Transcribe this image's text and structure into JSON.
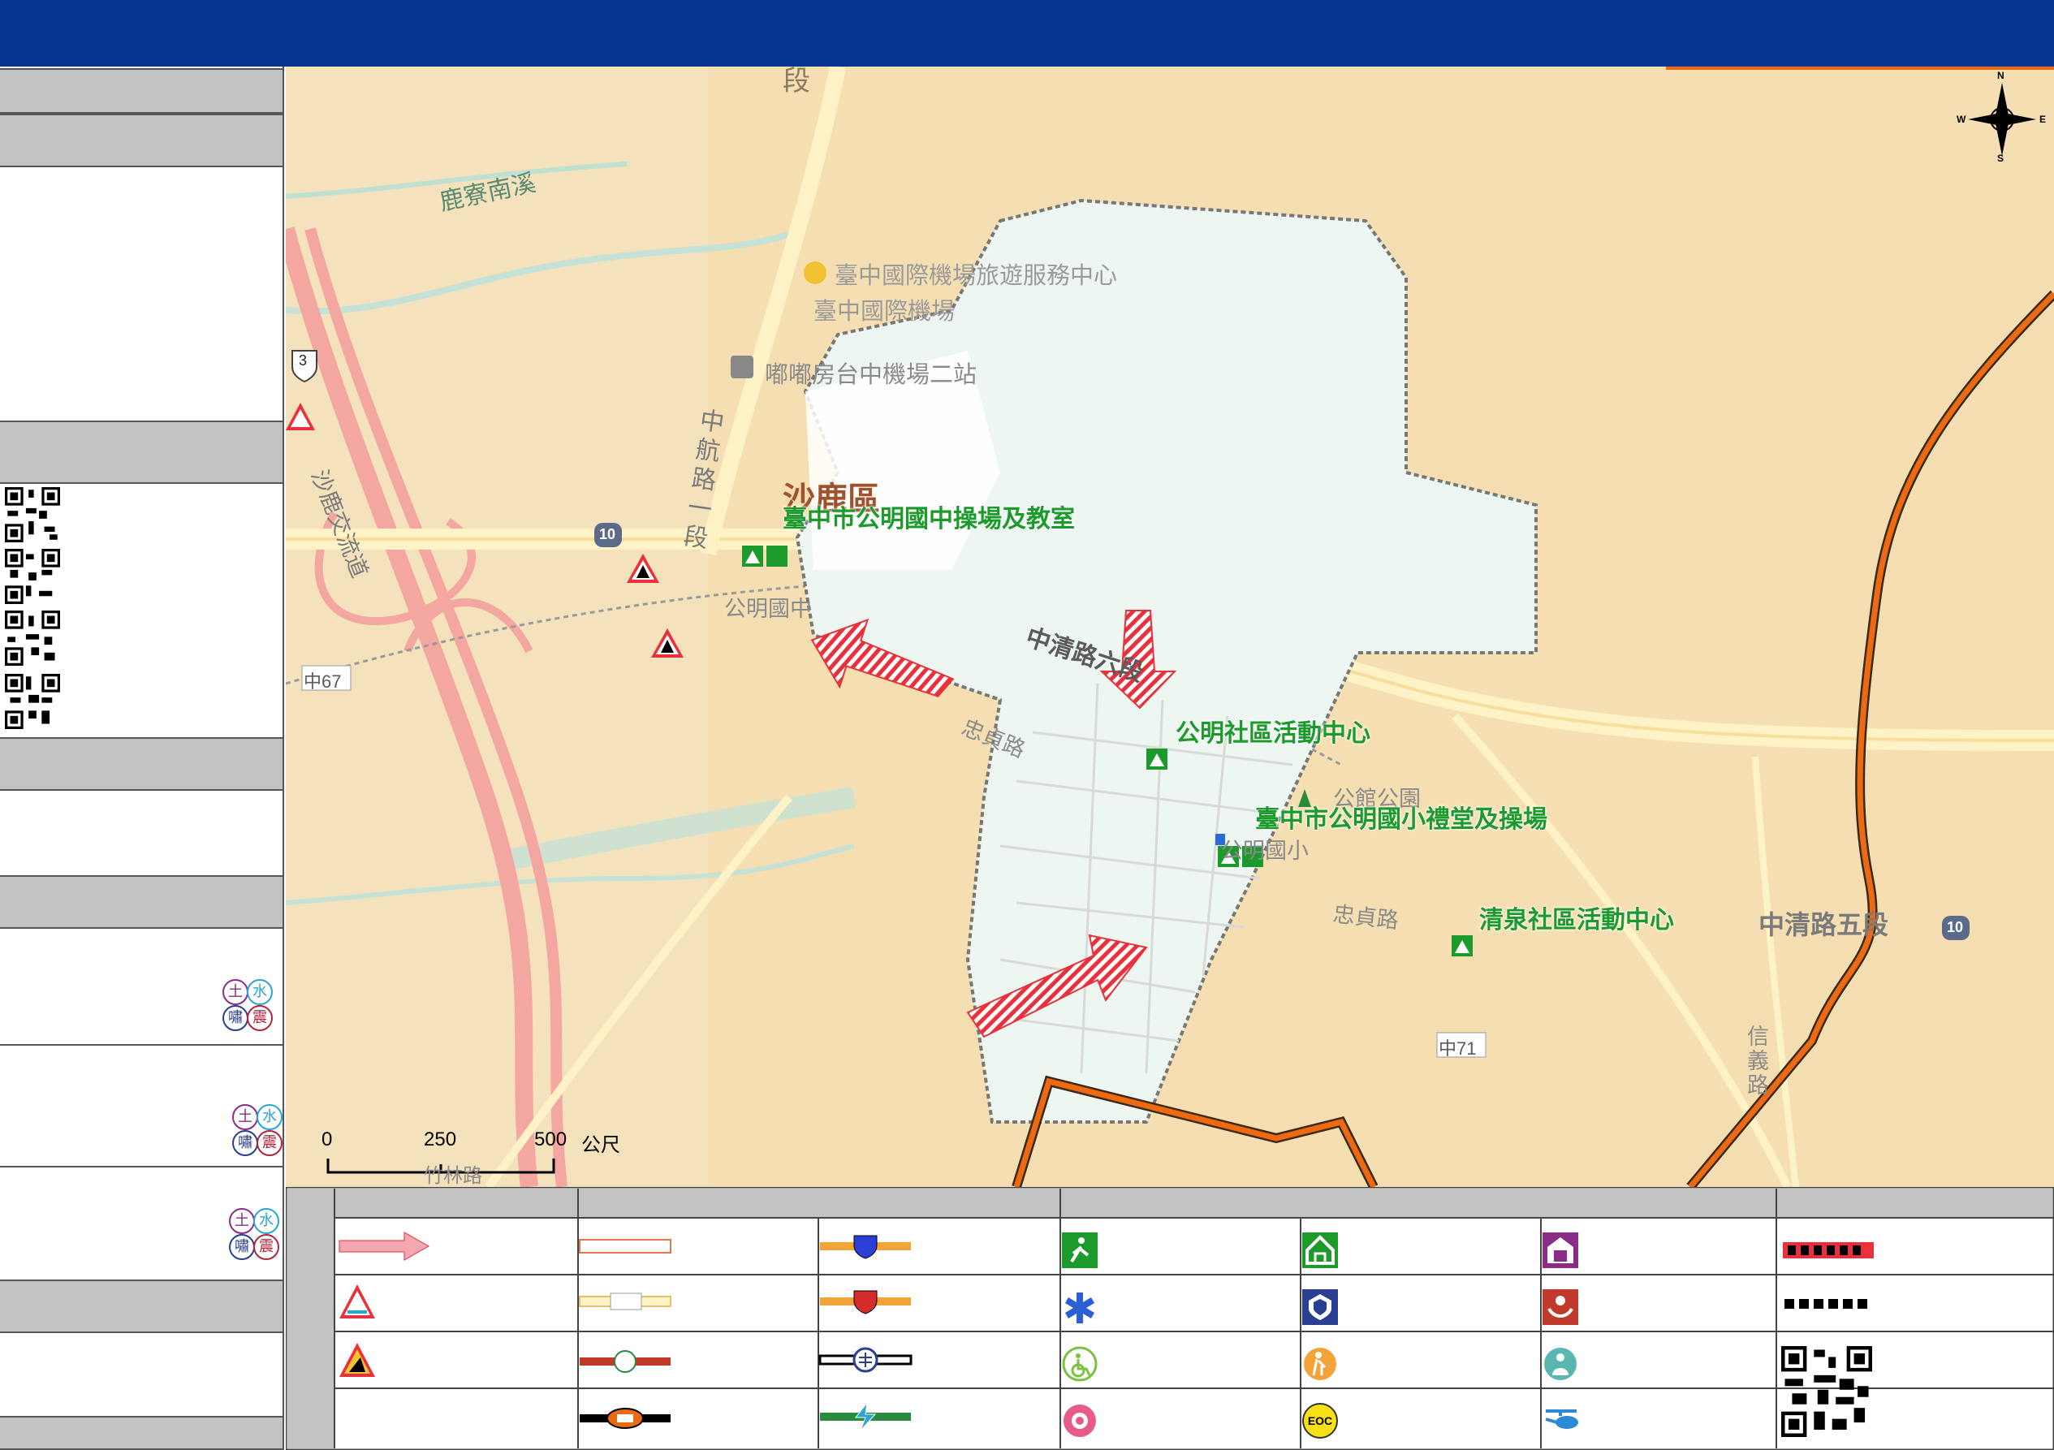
{
  "map": {
    "district_label": "沙鹿區",
    "labels": {
      "lukuo_stream": "鹿寮南溪",
      "airport_service": "臺中國際機場旅遊服務中心",
      "airport": "臺中國際機場",
      "parking": "嘟嘟房台中機場二站",
      "zhonghang_road": "中航路一段",
      "shalu_interchange": "沙鹿交流道",
      "gongming_junior_high": "公明國中",
      "zhongqing_6": "中清路六段",
      "zhongqing_5": "中清路五段",
      "zhongzhen_road_1": "忠貞路",
      "zhongzhen_road_2": "忠貞路",
      "gongguan_park": "公館公園",
      "gongming_elementary": "公明國小",
      "xinyi_road": "信義路",
      "zhong71": "中71",
      "zhong67": "中67",
      "route3": "3",
      "route10_a": "10",
      "route10_b": "10",
      "partial_duan": "段",
      "partial_bottom": "竹林路"
    },
    "shelters": [
      "臺中市公明國中操場及教室",
      "公明社區活動中心",
      "臺中市公明國小禮堂及操場",
      "清泉社區活動中心"
    ],
    "scale": {
      "t0": "0",
      "t1": "250",
      "t2": "500",
      "unit": "公尺"
    },
    "compass": {
      "n": "N",
      "s": "S",
      "e": "E",
      "w": "W"
    }
  },
  "hazard_badges": {
    "soil": "土",
    "water": "水",
    "tsunami": "嘯",
    "quake": "震"
  },
  "icons": [
    "evacuation-arrow-icon",
    "road-hazard-icon",
    "landslide-icon",
    "provincial-road-icon",
    "county-road-icon",
    "railway-station-icon",
    "high-speed-rail-icon",
    "emergency-exit-icon",
    "shelter-icon",
    "police-icon",
    "fire-dept-icon",
    "medical-icon",
    "accessible-icon",
    "elderly-icon",
    "childcare-icon",
    "rescue-icon",
    "eoc-icon",
    "helicopter-icon"
  ],
  "legend": {
    "eoc": "EOC"
  },
  "colors": {
    "header": "#03388e",
    "shelter_green": "#1d9a2c",
    "district_boundary": "#ee6a12",
    "evac_arrow": "#e8313a"
  }
}
